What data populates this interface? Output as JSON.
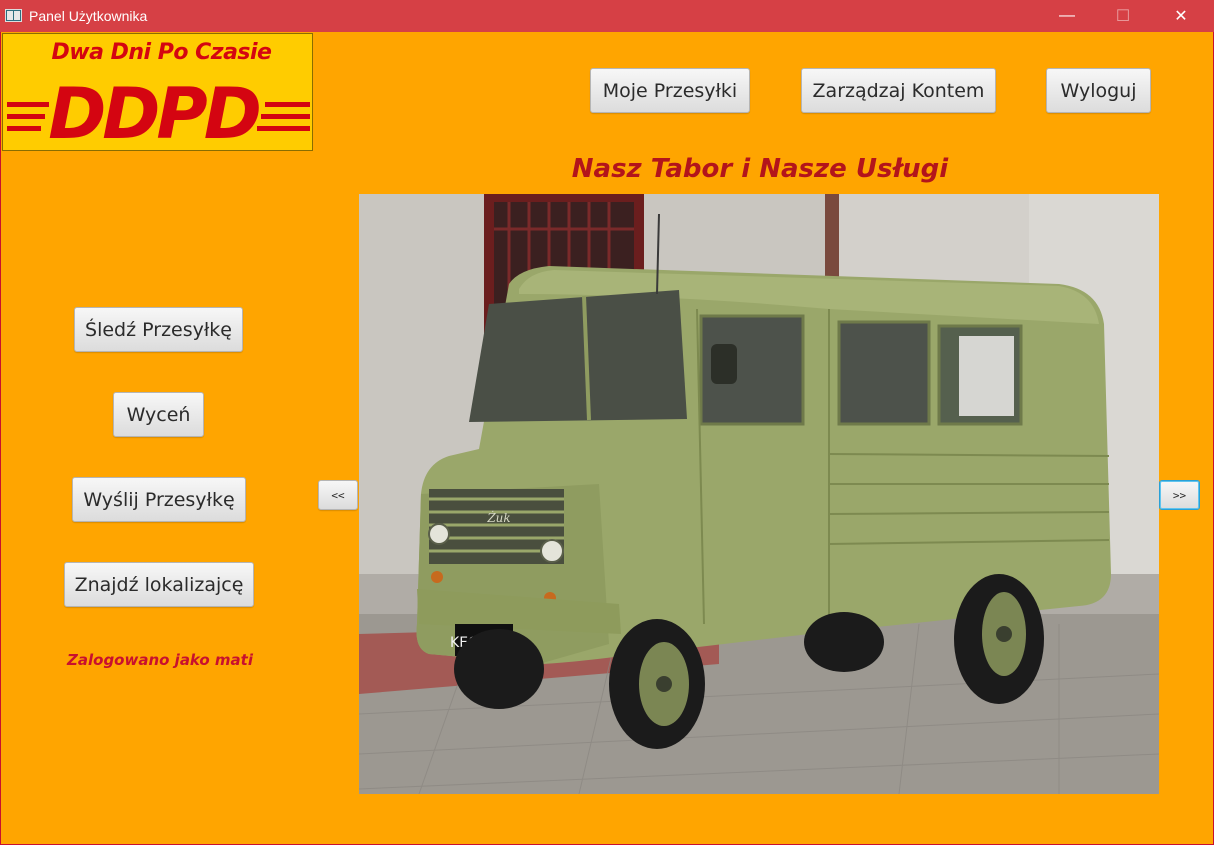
{
  "window": {
    "title": "Panel Użytkownika",
    "minimize_glyph": "—",
    "maximize_glyph": "☐",
    "close_glyph": "✕"
  },
  "logo": {
    "tagline": "Dwa Dni Po Czasie",
    "wordmark": "DDPD",
    "colors": {
      "background": "#ffcc00",
      "text": "#d40511"
    }
  },
  "top_nav": {
    "my_shipments": "Moje Przesyłki",
    "manage_account": "Zarządzaj Kontem",
    "logout": "Wyloguj"
  },
  "heading": "Nasz Tabor i Nasze Usługi",
  "side_menu": {
    "track": "Śledź Przesyłkę",
    "quote": "Wyceń",
    "send": "Wyślij Przesyłkę",
    "locate": "Znajdź lokalizajcę"
  },
  "status": "Zalogowano jako mati",
  "carousel": {
    "prev_label": "<<",
    "next_label": ">>",
    "plate_text": "KEC 3609",
    "badge_text": "Żuk"
  },
  "colors": {
    "background": "#ffa500",
    "titlebar": "#d64045",
    "heading": "#b3141b",
    "status": "#c8102e"
  }
}
